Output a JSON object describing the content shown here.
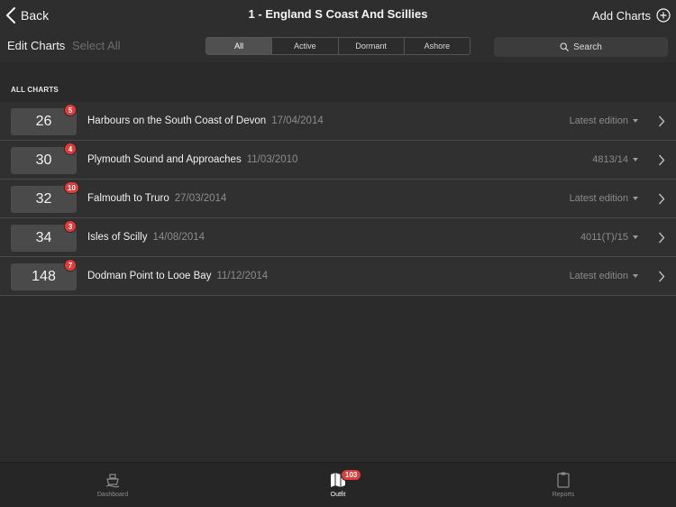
{
  "navbar": {
    "back_label": "Back",
    "title": "1 - England S Coast And Scillies",
    "add_label": "Add Charts"
  },
  "toolbar": {
    "edit_label": "Edit Charts",
    "select_all_label": "Select All",
    "segments": [
      {
        "label": "All",
        "active": true
      },
      {
        "label": "Active",
        "active": false
      },
      {
        "label": "Dormant",
        "active": false
      },
      {
        "label": "Ashore",
        "active": false
      }
    ],
    "search_placeholder": "Search"
  },
  "section": {
    "title": "ALL CHARTS"
  },
  "charts": [
    {
      "number": "26",
      "badge": "5",
      "name": "Harbours on the South Coast of Devon",
      "date": "17/04/2014",
      "edition": "Latest edition"
    },
    {
      "number": "30",
      "badge": "4",
      "name": "Plymouth Sound and Approaches",
      "date": "11/03/2010",
      "edition": "4813/14"
    },
    {
      "number": "32",
      "badge": "10",
      "name": "Falmouth to Truro",
      "date": "27/03/2014",
      "edition": "Latest edition"
    },
    {
      "number": "34",
      "badge": "3",
      "name": "Isles of Scilly",
      "date": "14/08/2014",
      "edition": "4011(T)/15"
    },
    {
      "number": "148",
      "badge": "7",
      "name": "Dodman Point to Looe Bay",
      "date": "11/12/2014",
      "edition": "Latest edition"
    }
  ],
  "tabbar": {
    "tabs": [
      {
        "label": "Dashboard",
        "icon": "ship-icon",
        "active": false
      },
      {
        "label": "Outfit",
        "icon": "charts-icon",
        "active": true,
        "badge": "103"
      },
      {
        "label": "Reports",
        "icon": "clipboard-icon",
        "active": false
      }
    ]
  },
  "colors": {
    "background": "#2b2b2b",
    "row": "#303030",
    "badge": "#e23b3b",
    "chart_number_box": "#4a4a4a"
  }
}
